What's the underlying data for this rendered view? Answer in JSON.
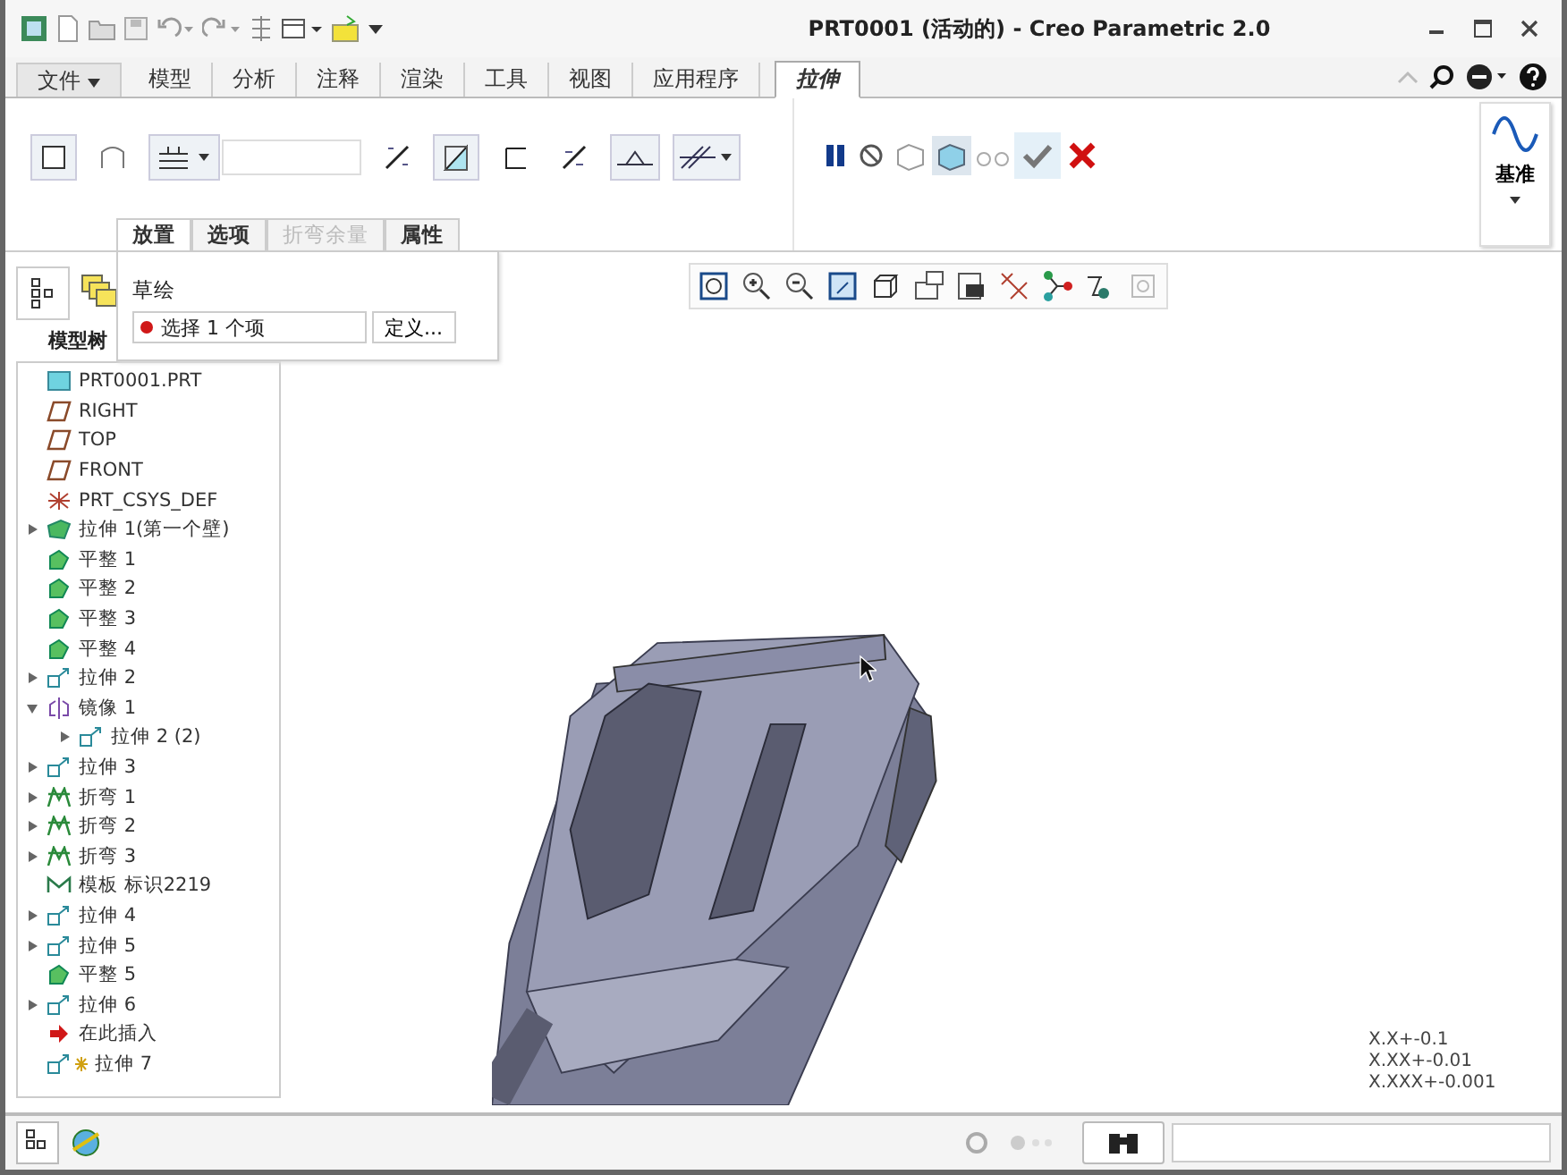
{
  "window": {
    "title": "PRT0001 (活动的) - Creo Parametric 2.0"
  },
  "ribbon_tabs": [
    {
      "label": "文件",
      "kind": "menu",
      "selected": false
    },
    {
      "label": "模型",
      "kind": "tab",
      "selected": false
    },
    {
      "label": "分析",
      "kind": "tab",
      "selected": false
    },
    {
      "label": "注释",
      "kind": "tab",
      "selected": false
    },
    {
      "label": "渲染",
      "kind": "tab",
      "selected": false
    },
    {
      "label": "工具",
      "kind": "tab",
      "selected": false
    },
    {
      "label": "视图",
      "kind": "tab",
      "selected": false
    },
    {
      "label": "应用程序",
      "kind": "tab",
      "selected": false
    },
    {
      "label": "拉伸",
      "kind": "tab",
      "selected": true
    }
  ],
  "datum_group": {
    "label": "基准"
  },
  "dashboard_tabs": [
    {
      "label": "放置",
      "selected": true,
      "disabled": false
    },
    {
      "label": "选项",
      "selected": false,
      "disabled": false
    },
    {
      "label": "折弯余量",
      "selected": false,
      "disabled": true
    },
    {
      "label": "属性",
      "selected": false,
      "disabled": false
    }
  ],
  "placement_panel": {
    "heading": "草绘",
    "selection": "选择 1 个项",
    "button": "定义..."
  },
  "model_tree": {
    "tab_label": "模型树",
    "items": [
      {
        "label": "PRT0001.PRT",
        "kind": "part"
      },
      {
        "label": "RIGHT",
        "kind": "plane"
      },
      {
        "label": "TOP",
        "kind": "plane"
      },
      {
        "label": "FRONT",
        "kind": "plane"
      },
      {
        "label": "PRT_CSYS_DEF",
        "kind": "csys"
      },
      {
        "label": "拉伸 1(第一个壁)",
        "kind": "wall",
        "expanded": false
      },
      {
        "label": "平整 1",
        "kind": "flat"
      },
      {
        "label": "平整 2",
        "kind": "flat"
      },
      {
        "label": "平整 3",
        "kind": "flat"
      },
      {
        "label": "平整 4",
        "kind": "flat"
      },
      {
        "label": "拉伸 2",
        "kind": "extrude",
        "expanded": false
      },
      {
        "label": "镜像 1",
        "kind": "mirror",
        "expanded": true,
        "children": [
          {
            "label": "拉伸 2 (2)",
            "kind": "extrude",
            "expanded": false
          }
        ]
      },
      {
        "label": "拉伸 3",
        "kind": "extrude",
        "expanded": false
      },
      {
        "label": "折弯 1",
        "kind": "bend",
        "expanded": false
      },
      {
        "label": "折弯 2",
        "kind": "bend",
        "expanded": false
      },
      {
        "label": "折弯 3",
        "kind": "bend",
        "expanded": false
      },
      {
        "label": "模板 标识2219",
        "kind": "form"
      },
      {
        "label": "拉伸 4",
        "kind": "extrude",
        "expanded": false
      },
      {
        "label": "拉伸 5",
        "kind": "extrude",
        "expanded": false
      },
      {
        "label": "平整 5",
        "kind": "flat"
      },
      {
        "label": "拉伸 6",
        "kind": "extrude",
        "expanded": false
      },
      {
        "label": "在此插入",
        "kind": "insert"
      },
      {
        "label": "拉伸 7",
        "kind": "new_extrude"
      }
    ]
  },
  "tolerances": [
    "X.X+-0.1",
    "X.XX+-0.01",
    "X.XXX+-0.001"
  ]
}
